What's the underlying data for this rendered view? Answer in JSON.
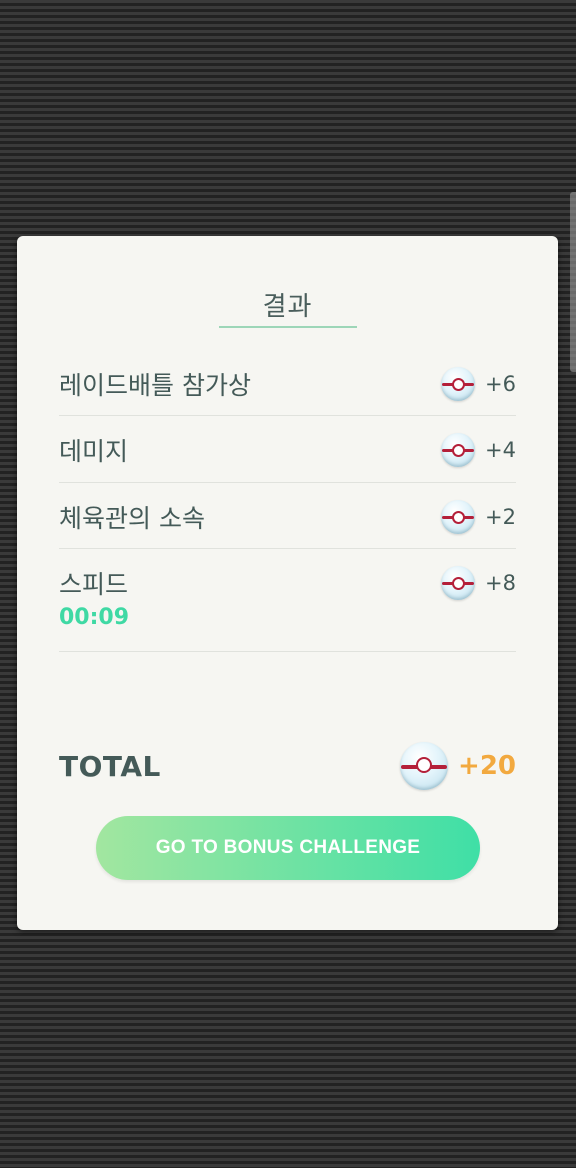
{
  "results": {
    "title": "결과",
    "rows": [
      {
        "label": "레이드배틀 참가상",
        "sub": "",
        "value": "+6",
        "icon": "premier-ball-icon"
      },
      {
        "label": "데미지",
        "sub": "",
        "value": "+4",
        "icon": "premier-ball-icon"
      },
      {
        "label": "체육관의 소속",
        "sub": "",
        "value": "+2",
        "icon": "premier-ball-icon"
      },
      {
        "label": "스피드",
        "sub": "00:09",
        "value": "+8",
        "icon": "premier-ball-icon"
      }
    ],
    "total_label": "TOTAL",
    "total_value": "+20",
    "bonus_button_label": "GO TO BONUS CHALLENGE"
  },
  "colors": {
    "text": "#445a58",
    "accent_green": "#3fd9a4",
    "total_orange": "#f2a93f",
    "ball_band": "#b4203a"
  }
}
